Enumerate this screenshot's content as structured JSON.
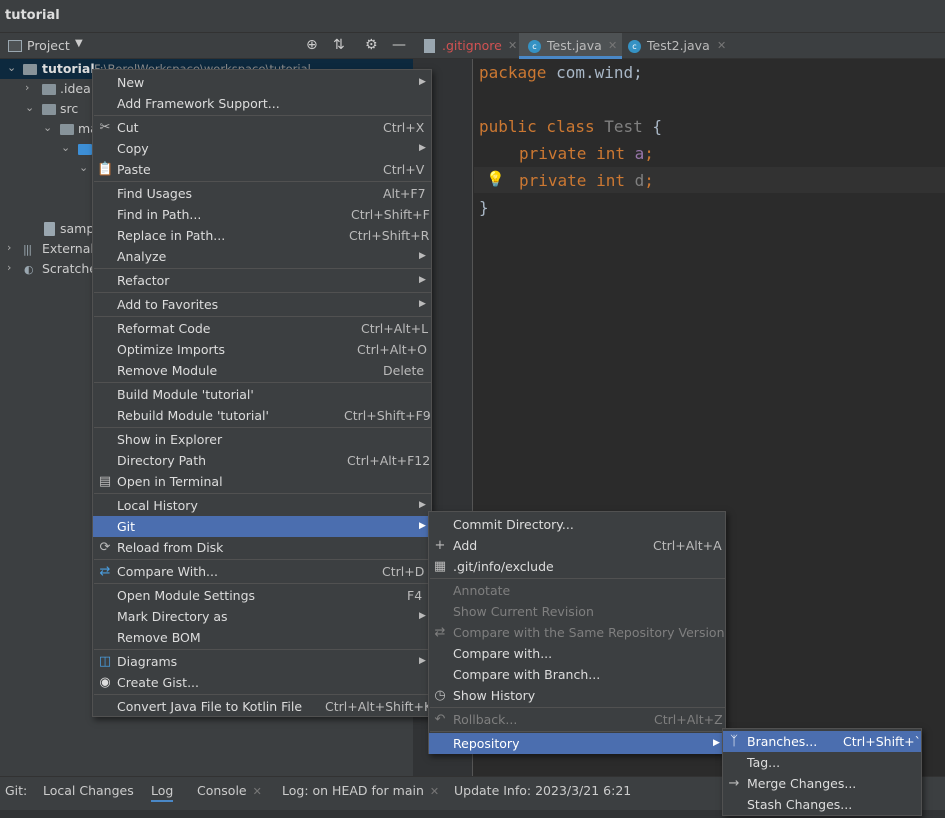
{
  "window": {
    "title": "tutorial"
  },
  "project_panel": {
    "label": "Project",
    "tree": [
      {
        "label": "tutorial",
        "path": "F:\\BorelWorkspace\\workspace\\tutorial"
      },
      {
        "label": ".idea"
      },
      {
        "label": "src"
      },
      {
        "label": "ma"
      },
      {
        "label": ""
      },
      {
        "label": "samp"
      },
      {
        "label": "External"
      },
      {
        "label": "Scratche"
      }
    ]
  },
  "editor_tabs": [
    {
      "label": ".gitignore",
      "color": "#d25252"
    },
    {
      "label": "Test.java"
    },
    {
      "label": "Test2.java"
    }
  ],
  "code": {
    "line1": {
      "kw": "package",
      "rest": " com.wind;"
    },
    "line3": {
      "kw": "public class",
      "name": " Test",
      "rest": " {"
    },
    "line4": {
      "kw": "private int",
      "field": "a",
      "semi": ";"
    },
    "line5": {
      "kw": "private int",
      "field": "d",
      "semi": ";"
    },
    "line6": "}"
  },
  "context_menu": {
    "items": [
      {
        "label": "New"
      },
      {
        "label": "Add Framework Support..."
      },
      {
        "label": "Cut",
        "shortcut": "Ctrl+X"
      },
      {
        "label": "Copy"
      },
      {
        "label": "Paste",
        "shortcut": "Ctrl+V"
      },
      {
        "label": "Find Usages",
        "shortcut": "Alt+F7"
      },
      {
        "label": "Find in Path...",
        "shortcut": "Ctrl+Shift+F"
      },
      {
        "label": "Replace in Path...",
        "shortcut": "Ctrl+Shift+R"
      },
      {
        "label": "Analyze"
      },
      {
        "label": "Refactor"
      },
      {
        "label": "Add to Favorites"
      },
      {
        "label": "Reformat Code",
        "shortcut": "Ctrl+Alt+L"
      },
      {
        "label": "Optimize Imports",
        "shortcut": "Ctrl+Alt+O"
      },
      {
        "label": "Remove Module",
        "shortcut": "Delete"
      },
      {
        "label": "Build Module 'tutorial'"
      },
      {
        "label": "Rebuild Module 'tutorial'",
        "shortcut": "Ctrl+Shift+F9"
      },
      {
        "label": "Show in Explorer"
      },
      {
        "label": "Directory Path",
        "shortcut": "Ctrl+Alt+F12"
      },
      {
        "label": "Open in Terminal"
      },
      {
        "label": "Local History"
      },
      {
        "label": "Git"
      },
      {
        "label": "Reload from Disk"
      },
      {
        "label": "Compare With...",
        "shortcut": "Ctrl+D"
      },
      {
        "label": "Open Module Settings",
        "shortcut": "F4"
      },
      {
        "label": "Mark Directory as"
      },
      {
        "label": "Remove BOM"
      },
      {
        "label": "Diagrams"
      },
      {
        "label": "Create Gist..."
      },
      {
        "label": "Convert Java File to Kotlin File",
        "shortcut": "Ctrl+Alt+Shift+K"
      }
    ]
  },
  "git_menu": {
    "items": [
      {
        "label": "Commit Directory..."
      },
      {
        "label": "Add",
        "shortcut": "Ctrl+Alt+A"
      },
      {
        "label": ".git/info/exclude"
      },
      {
        "label": "Annotate"
      },
      {
        "label": "Show Current Revision"
      },
      {
        "label": "Compare with the Same Repository Version"
      },
      {
        "label": "Compare with..."
      },
      {
        "label": "Compare with Branch..."
      },
      {
        "label": "Show History"
      },
      {
        "label": "Rollback...",
        "shortcut": "Ctrl+Alt+Z"
      },
      {
        "label": "Repository"
      }
    ]
  },
  "repo_menu": {
    "items": [
      {
        "label": "Branches...",
        "shortcut": "Ctrl+Shift+`"
      },
      {
        "label": "Tag..."
      },
      {
        "label": "Merge Changes..."
      },
      {
        "label": "Stash Changes..."
      }
    ]
  },
  "bottom_bar": {
    "prefix": "Git:",
    "tabs": [
      {
        "label": "Local Changes"
      },
      {
        "label": "Log"
      },
      {
        "label": "Console"
      },
      {
        "label": "Log: on HEAD for main"
      },
      {
        "label": "Update Info: 2023/3/21 6:21"
      }
    ]
  }
}
